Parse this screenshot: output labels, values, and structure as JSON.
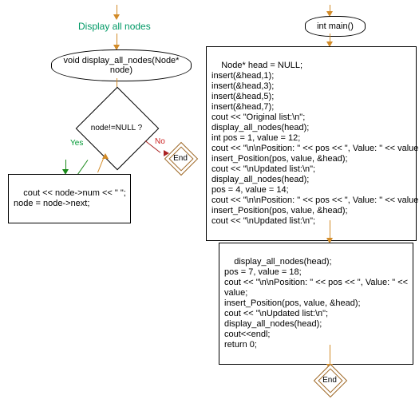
{
  "chart_data": {
    "type": "flowchart",
    "left_flow": {
      "title": "Display all nodes",
      "start_node": "void display_all_nodes(Node* node)",
      "decision": "node!=NULL ?",
      "yes_label": "Yes",
      "no_label": "No",
      "loop_body": "cout << node->num << \" \";\nnode = node->next;",
      "end": "End"
    },
    "right_flow": {
      "start_node": "int main()",
      "block1": "Node* head = NULL;\ninsert(&head,1);\ninsert(&head,3);\ninsert(&head,5);\ninsert(&head,7);\ncout << \"Original list:\\n\";\ndisplay_all_nodes(head);\nint pos = 1, value = 12;\ncout << \"\\n\\nPosition: \" << pos << \", Value: \" << value;\ninsert_Position(pos, value, &head);\ncout << \"\\nUpdated list:\\n\";\ndisplay_all_nodes(head);\npos = 4, value = 14;\ncout << \"\\n\\nPosition: \" << pos << \", Value: \" << value;\ninsert_Position(pos, value, &head);\ncout << \"\\nUpdated list:\\n\";",
      "block2": "display_all_nodes(head);\npos = 7, value = 18;\ncout << \"\\n\\nPosition: \" << pos << \", Value: \" <<\nvalue;\ninsert_Position(pos, value, &head);\ncout << \"\\nUpdated list:\\n\";\ndisplay_all_nodes(head);\ncout<<endl;\nreturn 0;",
      "end": "End"
    }
  }
}
